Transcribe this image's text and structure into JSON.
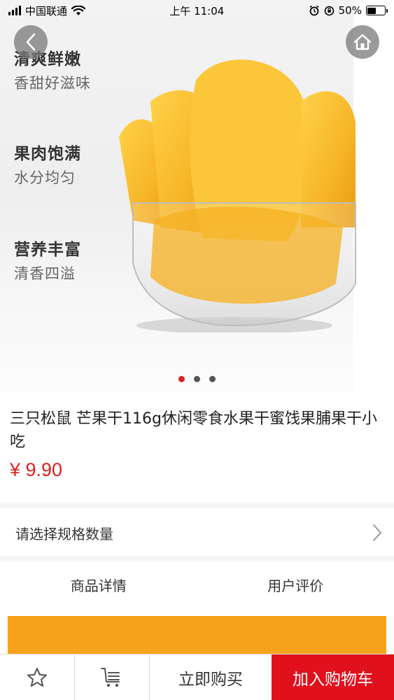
{
  "status_bar": {
    "carrier": "中国联通",
    "time": "上午 11:04",
    "battery": "50%",
    "battery_level": 0.5
  },
  "hero": {
    "features": [
      {
        "title": "清爽鲜嫩",
        "subtitle": "香甜好滋味"
      },
      {
        "title": "果肉饱满",
        "subtitle": "水分均匀"
      },
      {
        "title": "营养丰富",
        "subtitle": "清香四溢"
      }
    ],
    "carousel": {
      "count": 3,
      "active_index": 0
    }
  },
  "product": {
    "title": "三只松鼠 芒果干116g休闲零食水果干蜜饯果脯果干小吃",
    "price": "¥ 9.90"
  },
  "spec": {
    "label": "请选择规格数量"
  },
  "tabs": [
    {
      "label": "商品详情"
    },
    {
      "label": "用户评价"
    }
  ],
  "bottom_bar": {
    "favorite_icon": "star-icon",
    "cart_icon": "cart-icon",
    "buy_now": "立即购买",
    "add_to_cart": "加入购物车"
  },
  "colors": {
    "accent": "#e0111d",
    "price": "#e02020",
    "banner": "#f7a21b"
  }
}
